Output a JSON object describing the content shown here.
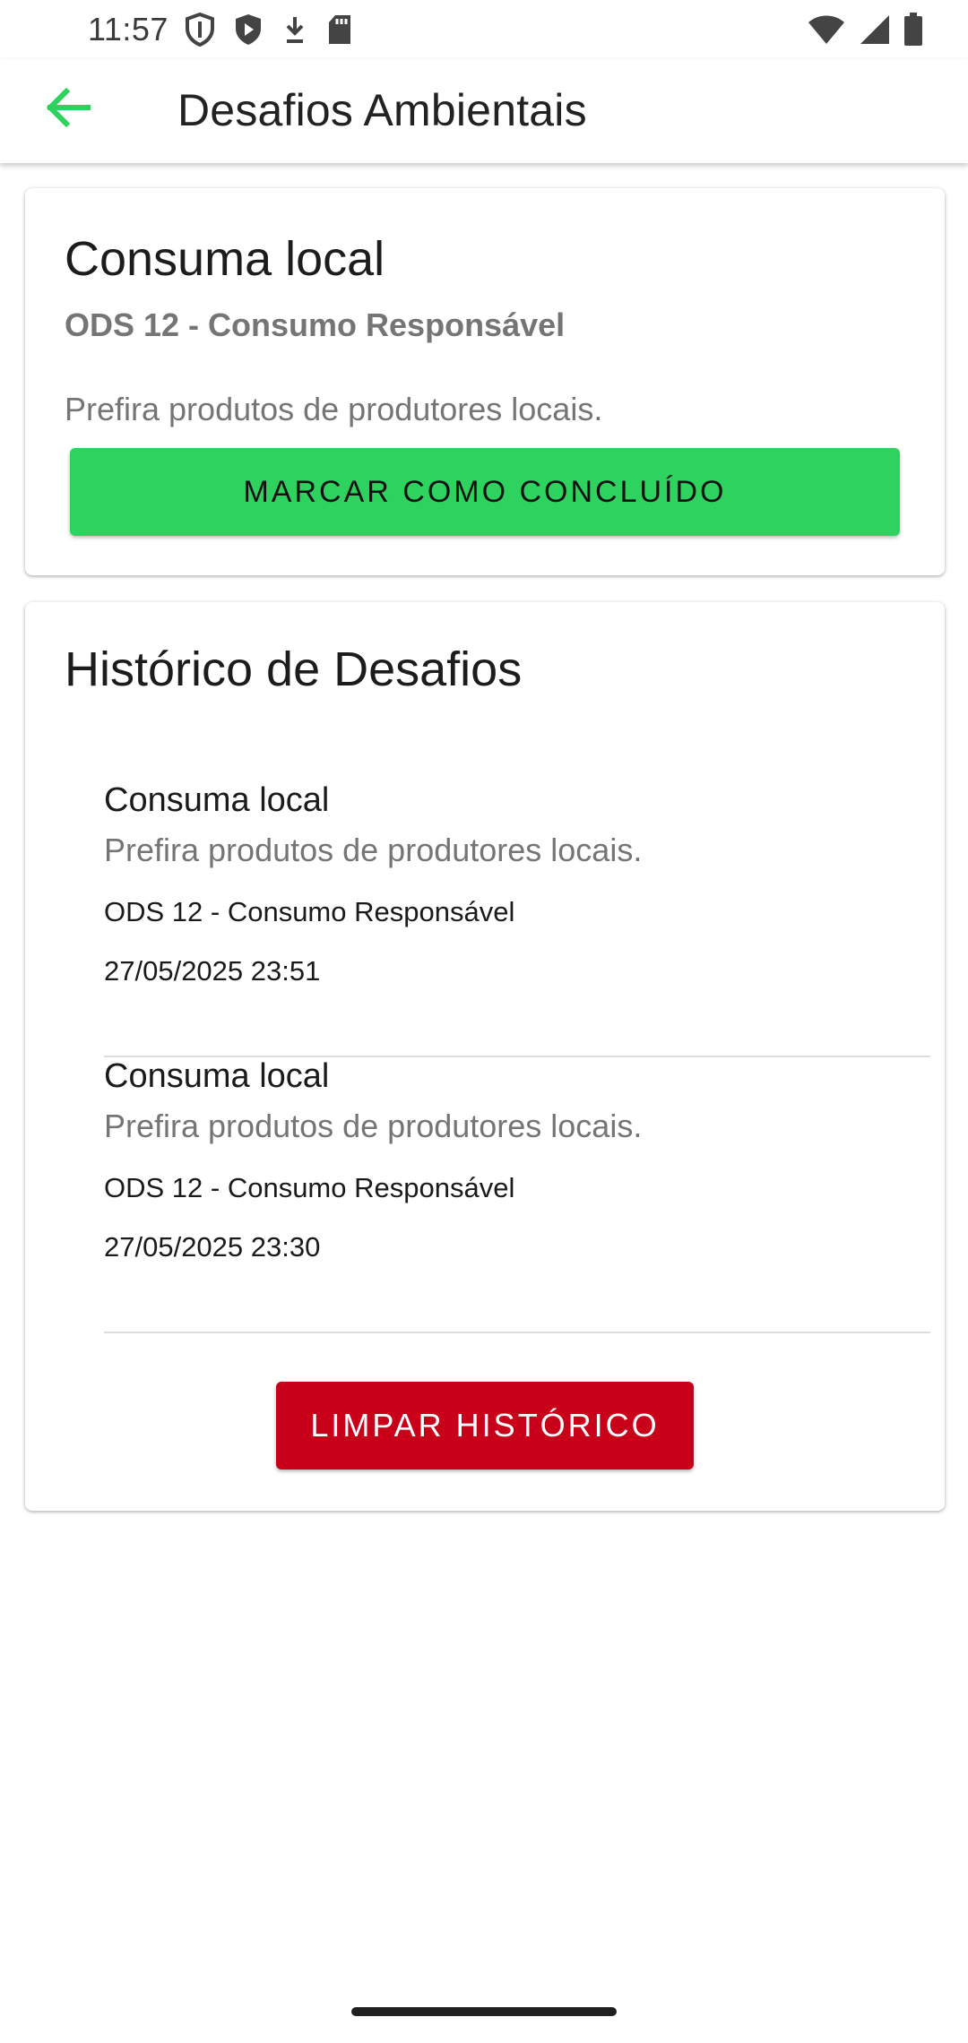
{
  "status_bar": {
    "time": "11:57",
    "left_icons": [
      "shield-outline-icon",
      "shield-play-icon",
      "download-icon",
      "sd-card-icon"
    ],
    "right_icons": [
      "wifi-icon",
      "signal-icon",
      "battery-icon"
    ]
  },
  "app_bar": {
    "title": "Desafios Ambientais",
    "back_icon": "arrow-left-icon",
    "accent_color": "#2ed35f"
  },
  "challenge_card": {
    "title": "Consuma local",
    "ods": "ODS 12 - Consumo Responsável",
    "description": "Prefira produtos de produtores locais.",
    "complete_button_label": "MARCAR COMO CONCLUÍDO",
    "complete_button_color": "#2ed35f"
  },
  "history_card": {
    "title": "Histórico de Desafios",
    "items": [
      {
        "title": "Consuma local",
        "description": "Prefira produtos de produtores locais.",
        "ods": "ODS 12 - Consumo Responsável",
        "date": "27/05/2025 23:51"
      },
      {
        "title": "Consuma local",
        "description": "Prefira produtos de produtores locais.",
        "ods": "ODS 12 - Consumo Responsável",
        "date": "27/05/2025 23:30"
      }
    ],
    "clear_button_label": "LIMPAR HISTÓRICO",
    "clear_button_color": "#c8001a"
  }
}
